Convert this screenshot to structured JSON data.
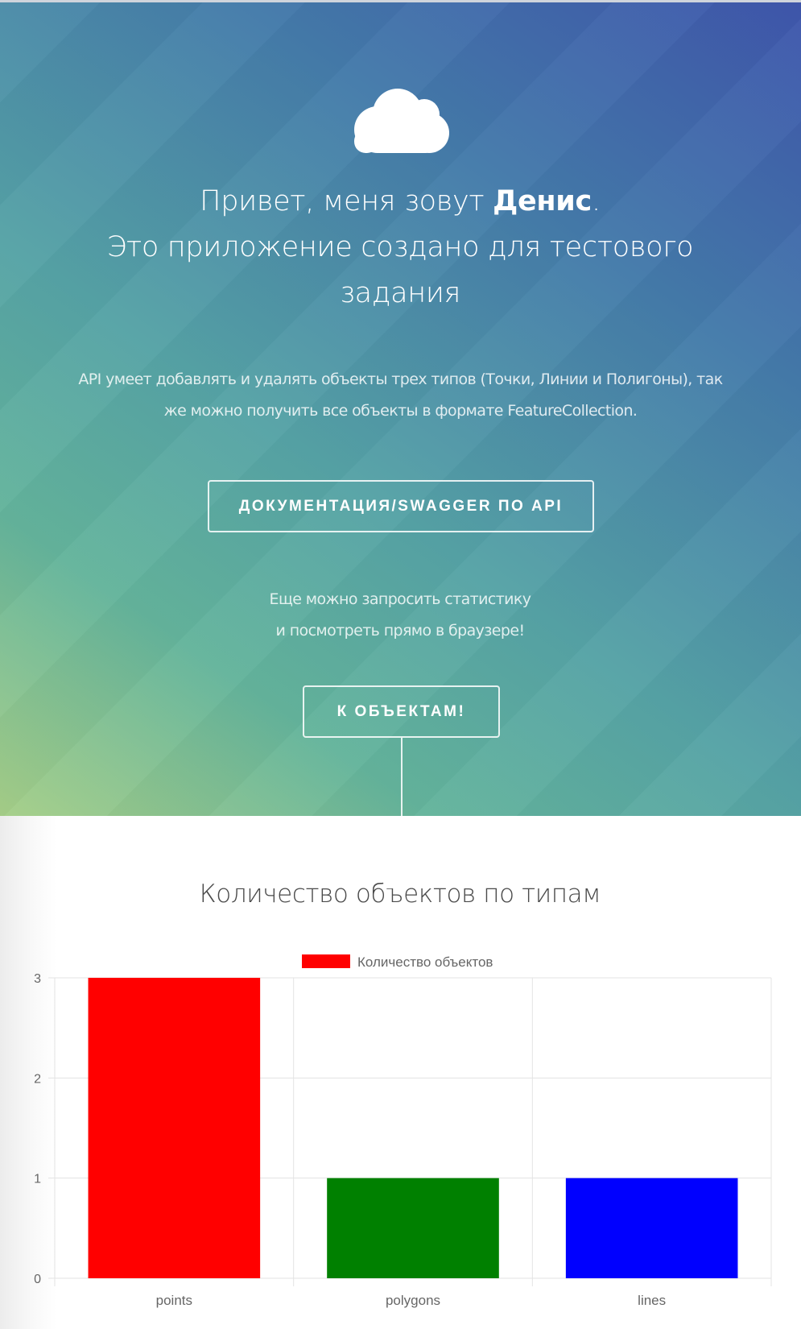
{
  "hero": {
    "greeting_prefix": "Привет, меня зовут ",
    "name": "Денис",
    "greeting_suffix": ".",
    "line2": "Это приложение создано для тестового",
    "line3": "задания",
    "description_line1": "API умеет добавлять и удалять объекты трех типов (Точки, Линии и Полигоны), так",
    "description_line2": "же можно получить все объекты в формате FeatureCollection.",
    "docs_button_label": "ДОКУМЕНТАЦИЯ/SWAGGER ПО API",
    "stats_line1": "Еще можно запросить статистику",
    "stats_line2": "и посмотреть прямо в браузере!",
    "objects_button_label": "К ОБЪЕКТАМ!",
    "icon": "cloud-icon",
    "gradient_colors": [
      "#3f56ac",
      "#447aaa",
      "#56a3a6",
      "#64b49c",
      "#a6cf88"
    ]
  },
  "stats_section": {
    "title": "Количество объектов по типам"
  },
  "chart_data": {
    "type": "bar",
    "title": "Количество объектов по типам",
    "categories": [
      "points",
      "polygons",
      "lines"
    ],
    "series": [
      {
        "name": "Количество объектов",
        "values": [
          3,
          1,
          1
        ],
        "colors": [
          "#ff0000",
          "#008000",
          "#0000ff"
        ]
      }
    ],
    "ylim": [
      0,
      3
    ],
    "yticks": [
      "0",
      "1",
      "2",
      "3"
    ],
    "grid": true,
    "legend": "top-center"
  }
}
